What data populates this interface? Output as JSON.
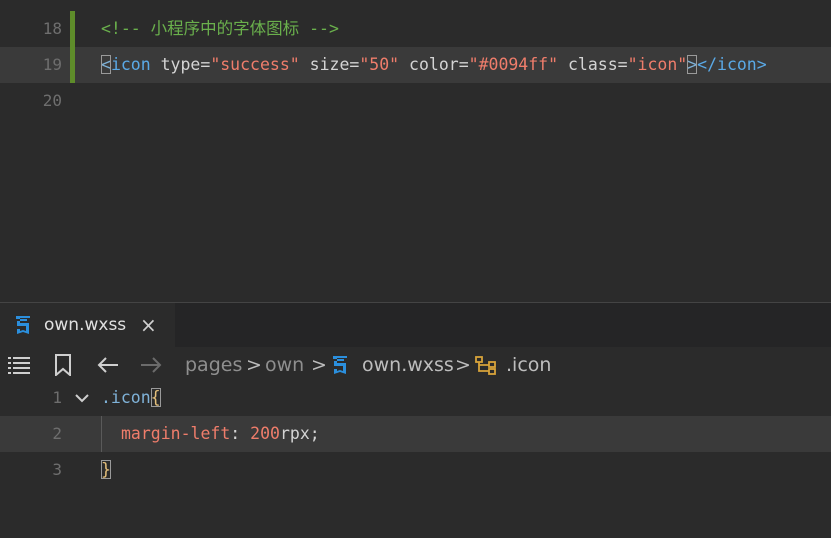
{
  "top_editor": {
    "lines": [
      {
        "number": "18",
        "text": "<!-- 小程序中的字体图标 -->"
      },
      {
        "number": "19",
        "tag_open": "icon",
        "attrs": [
          {
            "name": "type",
            "value": "\"success\""
          },
          {
            "name": "size",
            "value": "\"50\""
          },
          {
            "name": "color",
            "value": "\"#0094ff\""
          },
          {
            "name": "class",
            "value": "\"icon\""
          }
        ],
        "tag_close": "</icon>"
      },
      {
        "number": "20"
      }
    ]
  },
  "tab": {
    "label": "own.wxss",
    "close": "×",
    "icon": "css3-icon"
  },
  "breadcrumb": {
    "items": [
      "pages",
      "own",
      "own.wxss",
      ".icon"
    ],
    "separator": ">"
  },
  "bottom_editor": {
    "lines": [
      {
        "number": "1",
        "selector": ".icon",
        "brace": "{"
      },
      {
        "number": "2",
        "property": "margin-left",
        "colon": ":",
        "value_num": "200",
        "value_unit": "rpx",
        "semicolon": ";"
      },
      {
        "number": "3",
        "brace": "}"
      }
    ]
  },
  "colors": {
    "background": "#2b2b2b",
    "comment": "#6ab04c",
    "string": "#ef7d6b",
    "tag": "#5aa9e6",
    "css_icon": "#2b8fdd"
  }
}
